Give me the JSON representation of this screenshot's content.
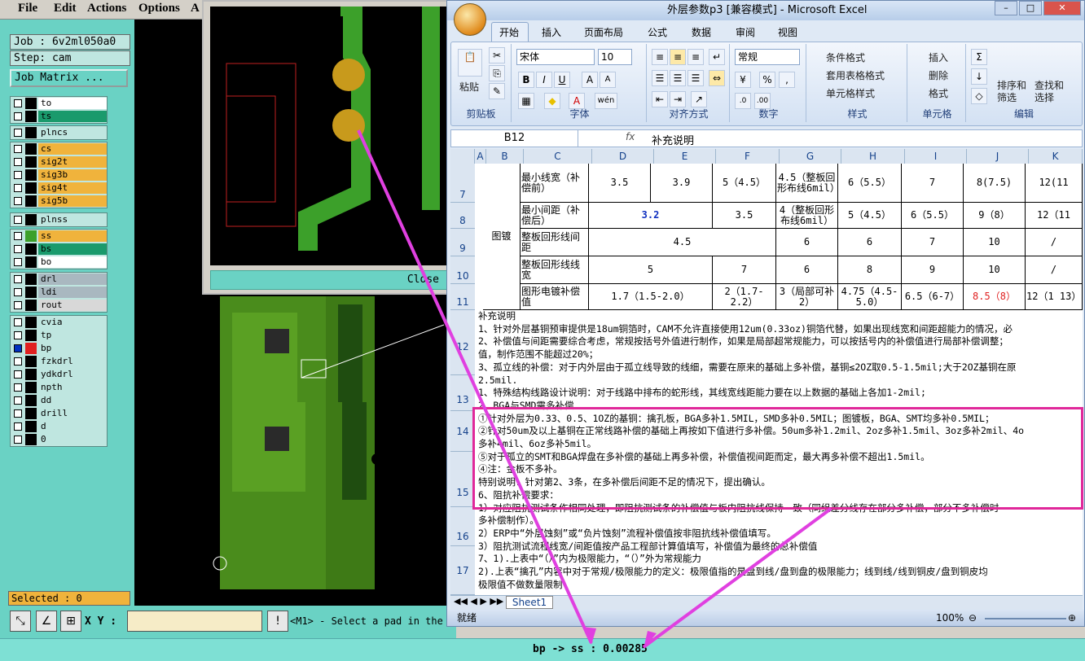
{
  "menu": {
    "items": [
      "File",
      "Edit",
      "Actions",
      "Options",
      "A"
    ]
  },
  "job": {
    "label": "Job : 6v2ml050a0",
    "step": "Step: cam",
    "matrix_button": "Job Matrix ..."
  },
  "layers": {
    "group1": [
      {
        "name": "to",
        "color": "#ffffff"
      },
      {
        "name": "ts",
        "color": "#1a9a6c"
      }
    ],
    "group2": [
      {
        "name": "plncs",
        "color": "#bfe6e0"
      }
    ],
    "group3": [
      {
        "name": "cs",
        "color": "#f0b33c"
      },
      {
        "name": "sig2t",
        "color": "#f0b33c"
      },
      {
        "name": "sig3b",
        "color": "#f0b33c"
      },
      {
        "name": "sig4t",
        "color": "#f0b33c"
      },
      {
        "name": "sig5b",
        "color": "#f0b33c"
      }
    ],
    "group4": [
      {
        "name": "plnss",
        "color": "#bfe6e0"
      }
    ],
    "group5": [
      {
        "name": "ss",
        "color": "#f0b33c"
      },
      {
        "name": "bs",
        "color": "#1a9a6c"
      },
      {
        "name": "bo",
        "color": "#ffffff"
      }
    ],
    "group6": [
      {
        "name": "drl",
        "color": "#a9b8c0"
      },
      {
        "name": "ldi",
        "color": "#a9b8c0"
      },
      {
        "name": "rout",
        "color": "#d8d8d8"
      }
    ],
    "group7": [
      {
        "name": "cvia",
        "color": "#bfe6e0"
      },
      {
        "name": "tp",
        "color": "#bfe6e0"
      },
      {
        "name": "bp",
        "color": "#bfe6e0"
      },
      {
        "name": "fzkdrl",
        "color": "#bfe6e0"
      },
      {
        "name": "ydkdrl",
        "color": "#bfe6e0"
      },
      {
        "name": "npth",
        "color": "#bfe6e0"
      },
      {
        "name": "dd",
        "color": "#bfe6e0"
      },
      {
        "name": "drill",
        "color": "#bfe6e0"
      },
      {
        "name": "d",
        "color": "#bfe6e0"
      },
      {
        "name": "0",
        "color": "#bfe6e0"
      }
    ]
  },
  "selected": "Selected : 0",
  "zoom_window": {
    "close_label": "Close"
  },
  "bottom": {
    "xy_label": "X Y :",
    "prompt": "<M1> - Select a pad in the",
    "measure": "bp -> ss : 0.00285"
  },
  "excel": {
    "title": "外层参数p3  [兼容模式] - Microsoft Excel",
    "tabs": [
      "开始",
      "插入",
      "页面布局",
      "公式",
      "数据",
      "审阅",
      "视图"
    ],
    "ribbon": {
      "paste": "粘贴",
      "clipboard": "剪贴板",
      "font_name": "宋体",
      "font_size": "10",
      "font": "字体",
      "align": "对齐方式",
      "number_format": "常规",
      "number": "数字",
      "cond_format": "条件格式",
      "table_format": "套用表格格式",
      "cell_style": "单元格样式",
      "styles": "样式",
      "insert": "插入",
      "delete": "删除",
      "format": "格式",
      "cells": "单元格",
      "sort": "排序和\n筛选",
      "find": "查找和\n选择",
      "editing": "编辑"
    },
    "name_box": "B12",
    "formula": "补充说明",
    "columns": [
      "A",
      "B",
      "C",
      "D",
      "E",
      "F",
      "G",
      "H",
      "I",
      "J",
      "K"
    ],
    "rows": [
      "7",
      "8",
      "9",
      "10",
      "11",
      "12",
      "13",
      "14",
      "15",
      "16",
      "17"
    ],
    "table": {
      "group_label": "图镀",
      "r7": [
        "最小线宽（补偿前）",
        "3.5",
        "3.9",
        "5（4.5）",
        "4.5（整板回形布线6mil）",
        "6（5.5）",
        "7",
        "8(7.5)",
        "12(11"
      ],
      "r8": [
        "最小间距（补偿后）",
        "3.2",
        "3.5",
        "4（整板回形布线6mil）",
        "5（4.5）",
        "6（5.5）",
        "9（8）",
        "12（11"
      ],
      "r9": [
        "整板回形线间距",
        "4.5",
        "6",
        "6",
        "7",
        "10",
        "/"
      ],
      "r10": [
        "整板回形线线宽",
        "5",
        "7",
        "6",
        "8",
        "9",
        "10",
        "/"
      ],
      "r11": [
        "图形电镀补偿值",
        "1.7（1.5-2.0）",
        "2（1.7-2.2）",
        "3（局部可补2）",
        "4.75（4.5-5.0）",
        "6.5（6-7）",
        "8.5（8）",
        "12（1 13）"
      ]
    },
    "notes": [
      "补充说明",
      "1、针对外层基铜预审提供是18um铜箔时，CAM不允许直接使用12um(0.33oz)铜箔代替，如果出现线宽和间距超能力的情况，必",
      "2、补偿值与间距需要综合考虑，常规按括号外值进行制作，如果是局部超常规能力，可以按括号内的补偿值进行局部补偿调整；",
      "值，制作范围不能超过20%；",
      "3、孤立线的补偿：对于内外层由于孤立线导致的线细，需要在原来的基础上多补偿，基铜≤2OZ取0.5-1.5mil;大于2OZ基铜在原",
      "2.5mil.",
      "1、特殊结构线路设计说明：对于线路中排布的蛇形线，其线宽线距能力要在以上数据的基础上各加1-2mil;",
      "2、BGA与SMD需多补偿.",
      "①针对外层为0.33、0.5、1OZ的基铜：擒孔板，BGA多补1.5MIL，SMD多补0.5MIL；图镀板，BGA、SMT均多补0.5MIL；",
      "②针对50um及以上基铜在正常线路补偿的基础上再按如下值进行多补偿。50um多补1.2mil、2oz多补1.5mil、3oz多补2mil、4o",
      "多补4mil、6oz多补5mil。",
      "⑤对于孤立的SMT和BGA焊盘在多补偿的基础上再多补偿，补偿值视间距而定，最大再多补偿不超出1.5mil。",
      "④注：金板不多补。",
      "特别说明：针对第2、3条，在多补偿后间距不足的情况下，提出确认。",
      "6、阻抗补偿要求：",
      "1）对应阻抗测试条作相同处理，即阻抗测试条的补偿值与板内阻抗线保持一致（同组差分线存在部分多补偿，部分不多补偿时",
      "多补偿制作）。",
      "2）ERP中“外层蚀刻”或“负片蚀刻”流程补偿值按非阻抗线补偿值填写。",
      "3）阻抗测试流程线宽/间距值按产品工程部计算值填写，补偿值为最终的总补偿值",
      "7、1).上表中“（）”内为极限能力，“（）”外为常规能力",
      "   2).上表“擒孔”内容中对于常规/极限能力的定义：极限值指的是盘到线/盘到盘的极限能力；线到线/线到铜皮/盘到铜皮均",
      "极限值不做数量限制"
    ],
    "sheet_tab": "Sheet1",
    "status_ready": "就绪",
    "zoom": "100%"
  }
}
